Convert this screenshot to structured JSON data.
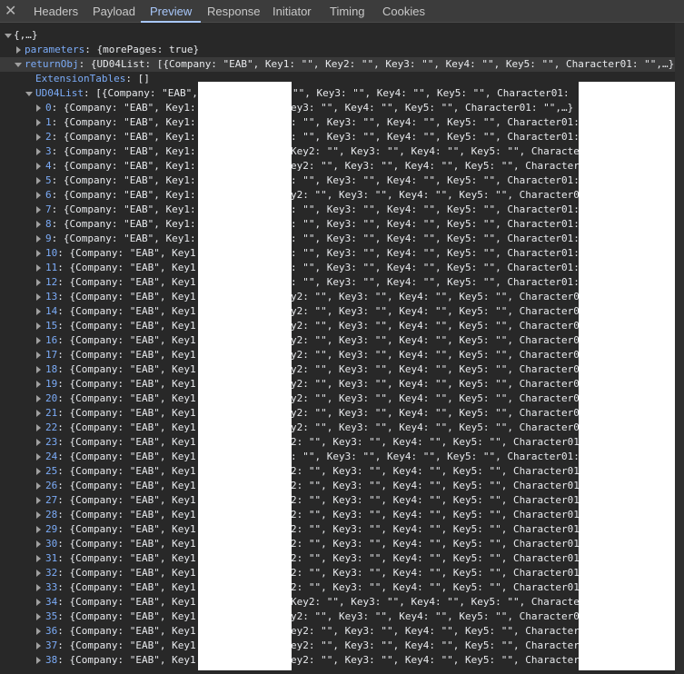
{
  "tabs": [
    "Headers",
    "Payload",
    "Preview",
    "Response",
    "Initiator",
    "Timing",
    "Cookies"
  ],
  "active_tab": "Preview",
  "root": "{,…}",
  "parameters": {
    "key": "parameters",
    "value": "{morePages: true}"
  },
  "returnObj": {
    "key": "returnObj",
    "value": "{UD04List: [{Company: \"EAB\", Key1: \"\", Key2: \"\", Key3: \"\", Key4: \"\", Key5: \"\", Character01: \"\",…},…"
  },
  "extensionTables": {
    "key": "ExtensionTables",
    "value": "[]"
  },
  "ud04list": {
    "key": "UD04List",
    "value_prefix": "[{Company: \"EAB\", ",
    "value_tail": "\"\", Key3: \"\", Key4: \"\", Key5: \"\", Character01:"
  },
  "row_prefix": "{Company: \"EAB\", Key1:",
  "rows": [
    {
      "i": "0",
      "tail": "ey3: \"\", Key4: \"\", Key5: \"\", Character01: \"\",…}"
    },
    {
      "i": "1",
      "tail": ": \"\", Key3: \"\", Key4: \"\", Key5: \"\", Character01:"
    },
    {
      "i": "2",
      "tail": ": \"\", Key3: \"\", Key4: \"\", Key5: \"\", Character01:"
    },
    {
      "i": "3",
      "tail": "Key2: \"\", Key3: \"\", Key4: \"\", Key5: \"\", Characte"
    },
    {
      "i": "4",
      "tail": "ey2: \"\", Key3: \"\", Key4: \"\", Key5: \"\", Character"
    },
    {
      "i": "5",
      "tail": ": \"\", Key3: \"\", Key4: \"\", Key5: \"\", Character01:"
    },
    {
      "i": "6",
      "tail": "y2: \"\", Key3: \"\", Key4: \"\", Key5: \"\", Character0"
    },
    {
      "i": "7",
      "tail": ": \"\", Key3: \"\", Key4: \"\", Key5: \"\", Character01:"
    },
    {
      "i": "8",
      "tail": ": \"\", Key3: \"\", Key4: \"\", Key5: \"\", Character01:"
    },
    {
      "i": "9",
      "tail": ": \"\", Key3: \"\", Key4: \"\", Key5: \"\", Character01:"
    },
    {
      "i": "10",
      "tail": ": \"\", Key3: \"\", Key4: \"\", Key5: \"\", Character01:"
    },
    {
      "i": "11",
      "tail": ": \"\", Key3: \"\", Key4: \"\", Key5: \"\", Character01:"
    },
    {
      "i": "12",
      "tail": ": \"\", Key3: \"\", Key4: \"\", Key5: \"\", Character01:"
    },
    {
      "i": "13",
      "tail": "y2: \"\", Key3: \"\", Key4: \"\", Key5: \"\", Character0"
    },
    {
      "i": "14",
      "tail": "y2: \"\", Key3: \"\", Key4: \"\", Key5: \"\", Character0"
    },
    {
      "i": "15",
      "tail": "y2: \"\", Key3: \"\", Key4: \"\", Key5: \"\", Character0"
    },
    {
      "i": "16",
      "tail": "y2: \"\", Key3: \"\", Key4: \"\", Key5: \"\", Character0"
    },
    {
      "i": "17",
      "tail": "y2: \"\", Key3: \"\", Key4: \"\", Key5: \"\", Character0"
    },
    {
      "i": "18",
      "tail": "y2: \"\", Key3: \"\", Key4: \"\", Key5: \"\", Character0"
    },
    {
      "i": "19",
      "tail": "y2: \"\", Key3: \"\", Key4: \"\", Key5: \"\", Character0"
    },
    {
      "i": "20",
      "tail": "y2: \"\", Key3: \"\", Key4: \"\", Key5: \"\", Character0"
    },
    {
      "i": "21",
      "tail": "y2: \"\", Key3: \"\", Key4: \"\", Key5: \"\", Character0"
    },
    {
      "i": "22",
      "tail": "y2: \"\", Key3: \"\", Key4: \"\", Key5: \"\", Character0"
    },
    {
      "i": "23",
      "tail": "2: \"\", Key3: \"\", Key4: \"\", Key5: \"\", Character01"
    },
    {
      "i": "24",
      "tail": ": \"\", Key3: \"\", Key4: \"\", Key5: \"\", Character01:"
    },
    {
      "i": "25",
      "tail": "2: \"\", Key3: \"\", Key4: \"\", Key5: \"\", Character01"
    },
    {
      "i": "26",
      "tail": "2: \"\", Key3: \"\", Key4: \"\", Key5: \"\", Character01"
    },
    {
      "i": "27",
      "tail": "2: \"\", Key3: \"\", Key4: \"\", Key5: \"\", Character01"
    },
    {
      "i": "28",
      "tail": "2: \"\", Key3: \"\", Key4: \"\", Key5: \"\", Character01"
    },
    {
      "i": "29",
      "tail": "2: \"\", Key3: \"\", Key4: \"\", Key5: \"\", Character01"
    },
    {
      "i": "30",
      "tail": "2: \"\", Key3: \"\", Key4: \"\", Key5: \"\", Character01"
    },
    {
      "i": "31",
      "tail": "2: \"\", Key3: \"\", Key4: \"\", Key5: \"\", Character01"
    },
    {
      "i": "32",
      "tail": "2: \"\", Key3: \"\", Key4: \"\", Key5: \"\", Character01"
    },
    {
      "i": "33",
      "tail": "2: \"\", Key3: \"\", Key4: \"\", Key5: \"\", Character01"
    },
    {
      "i": "34",
      "tail": "Key2: \"\", Key3: \"\", Key4: \"\", Key5: \"\", Characte"
    },
    {
      "i": "35",
      "tail": "y2: \"\", Key3: \"\", Key4: \"\", Key5: \"\", Character0"
    },
    {
      "i": "36",
      "tail": "ey2: \"\", Key3: \"\", Key4: \"\", Key5: \"\", Character"
    },
    {
      "i": "37",
      "tail": "ey2: \"\", Key3: \"\", Key4: \"\", Key5: \"\", Character"
    },
    {
      "i": "38",
      "tail": "ey2: \"\", Key3: \"\", Key4: \"\", Key5: \"\", Character"
    }
  ]
}
